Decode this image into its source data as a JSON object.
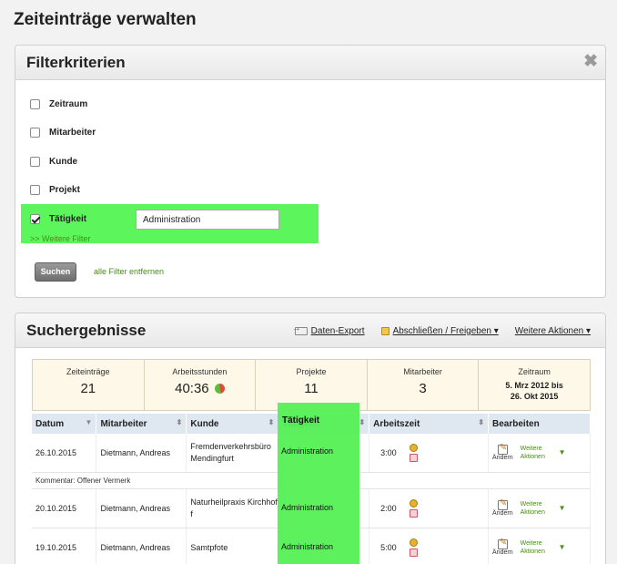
{
  "page": {
    "title": "Zeiteinträge verwalten"
  },
  "filter": {
    "title": "Filterkriterien",
    "items": [
      {
        "label": "Zeitraum",
        "checked": false
      },
      {
        "label": "Mitarbeiter",
        "checked": false
      },
      {
        "label": "Kunde",
        "checked": false
      },
      {
        "label": "Projekt",
        "checked": false
      },
      {
        "label": "Tätigkeit",
        "checked": true
      }
    ],
    "activity_value": "Administration",
    "more_filters": ">> Weitere Filter",
    "search_button": "Suchen",
    "clear_link": "alle Filter entfernen"
  },
  "results": {
    "title": "Suchergebnisse",
    "actions": [
      "Daten-Export",
      "Abschließen / Freigeben ▾",
      "Weitere Aktionen ▾"
    ],
    "summary": {
      "entries_label": "Zeiteinträge",
      "entries_value": "21",
      "hours_label": "Arbeitsstunden",
      "hours_value": "40:36",
      "projects_label": "Projekte",
      "projects_value": "11",
      "staff_label": "Mitarbeiter",
      "staff_value": "3",
      "range_label": "Zeitraum",
      "range_from": "5. Mrz 2012 bis",
      "range_to": "26. Okt 2015"
    },
    "columns": [
      "Datum",
      "Mitarbeiter",
      "Kunde",
      "Tätigkeit",
      "Arbeitszeit",
      "Bearbeiten"
    ],
    "edit_label": "Ändern",
    "more_actions": "Weitere Aktionen",
    "rows": [
      {
        "date": "26.10.2015",
        "employee": "Dietmann, Andreas",
        "customer": "Fremdenverkehrsbüro Mendingfurt",
        "activity": "Administration",
        "time": "3:00"
      },
      {
        "date": "20.10.2015",
        "employee": "Dietmann, Andreas",
        "customer": "Naturheilpraxis Kirchhoff",
        "activity": "Administration",
        "time": "2:00"
      },
      {
        "date": "19.10.2015",
        "employee": "Dietmann, Andreas",
        "customer": "Samtpfote",
        "activity": "Administration",
        "time": "5:00"
      }
    ],
    "comment": "Kommentar: Offener Vermerk"
  },
  "colors": {
    "highlight": "#55f055",
    "link_green": "#4a8a1a",
    "summary_bg": "#fdf8e8",
    "header_bg": "#dfe7f1"
  }
}
